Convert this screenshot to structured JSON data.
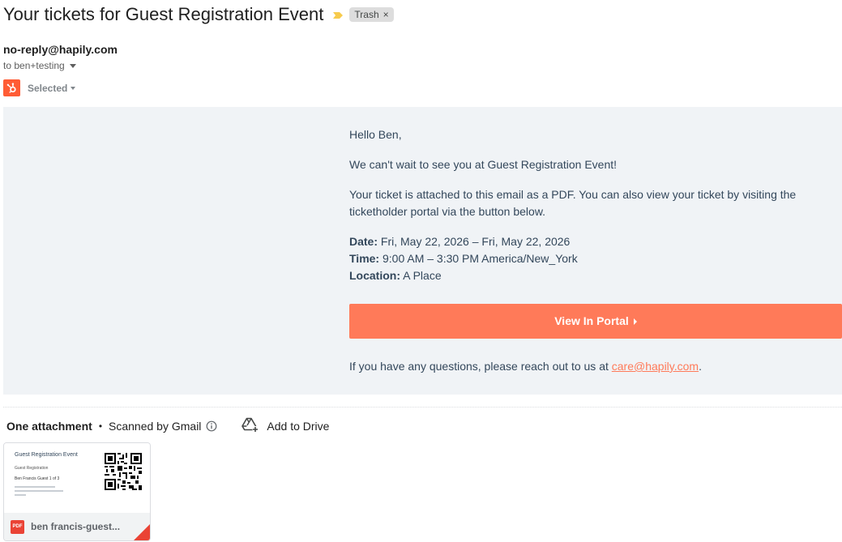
{
  "email": {
    "subject": "Your tickets for Guest Registration Event",
    "label": "Trash",
    "label_close": "×",
    "from": "no-reply@hapily.com",
    "to": "to ben+testing",
    "addon_status": "Selected"
  },
  "body": {
    "greeting": "Hello Ben,",
    "intro": "We can't wait to see you at Guest Registration Event!",
    "ticket_text": "Your ticket is attached to this email as a PDF. You can also view your ticket by visiting the ticketholder portal via the button below.",
    "date_label": "Date:",
    "date_value": "Fri, May 22, 2026 – Fri, May 22, 2026",
    "time_label": "Time:",
    "time_value": "9:00 AM – 3:30 PM America/New_York",
    "location_label": "Location:",
    "location_value": "A Place",
    "portal_button": "View In Portal",
    "questions_text": "If you have any questions, please reach out to us at ",
    "contact_email": "care@hapily.com",
    "questions_end": "."
  },
  "attachments": {
    "count_label": "One attachment",
    "separator": "•",
    "scan_status": "Scanned by Gmail",
    "add_to_drive": "Add to Drive",
    "file": {
      "name": "ben francis-guest...",
      "type_badge": "PDF",
      "preview_title": "Guest Registration Event",
      "preview_subtitle": "Guest Registration",
      "preview_name": "Ben Francis Guest 1 of 3"
    }
  },
  "colors": {
    "accent": "#ff7a59",
    "body_bg": "#f0f3f6",
    "text": "#33475b",
    "hubspot_orange": "#ff5c35",
    "label_bg": "#dddddd"
  },
  "icons": [
    "importance-marker-icon",
    "close-icon",
    "chevron-down-icon",
    "hubspot-logo-icon",
    "info-icon",
    "add-to-drive-icon",
    "pdf-icon",
    "qr-code-icon",
    "chevron-right-icon"
  ]
}
